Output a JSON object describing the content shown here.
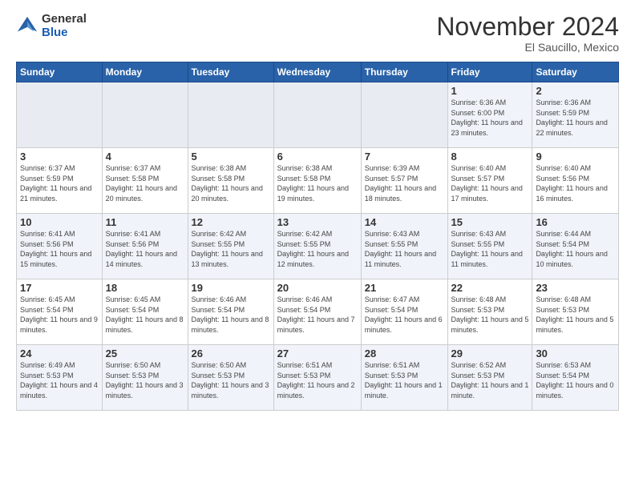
{
  "logo": {
    "general": "General",
    "blue": "Blue"
  },
  "header": {
    "month": "November 2024",
    "location": "El Saucillo, Mexico"
  },
  "weekdays": [
    "Sunday",
    "Monday",
    "Tuesday",
    "Wednesday",
    "Thursday",
    "Friday",
    "Saturday"
  ],
  "rows": [
    [
      {
        "day": "",
        "info": ""
      },
      {
        "day": "",
        "info": ""
      },
      {
        "day": "",
        "info": ""
      },
      {
        "day": "",
        "info": ""
      },
      {
        "day": "",
        "info": ""
      },
      {
        "day": "1",
        "info": "Sunrise: 6:36 AM\nSunset: 6:00 PM\nDaylight: 11 hours and 23 minutes."
      },
      {
        "day": "2",
        "info": "Sunrise: 6:36 AM\nSunset: 5:59 PM\nDaylight: 11 hours and 22 minutes."
      }
    ],
    [
      {
        "day": "3",
        "info": "Sunrise: 6:37 AM\nSunset: 5:59 PM\nDaylight: 11 hours and 21 minutes."
      },
      {
        "day": "4",
        "info": "Sunrise: 6:37 AM\nSunset: 5:58 PM\nDaylight: 11 hours and 20 minutes."
      },
      {
        "day": "5",
        "info": "Sunrise: 6:38 AM\nSunset: 5:58 PM\nDaylight: 11 hours and 20 minutes."
      },
      {
        "day": "6",
        "info": "Sunrise: 6:38 AM\nSunset: 5:58 PM\nDaylight: 11 hours and 19 minutes."
      },
      {
        "day": "7",
        "info": "Sunrise: 6:39 AM\nSunset: 5:57 PM\nDaylight: 11 hours and 18 minutes."
      },
      {
        "day": "8",
        "info": "Sunrise: 6:40 AM\nSunset: 5:57 PM\nDaylight: 11 hours and 17 minutes."
      },
      {
        "day": "9",
        "info": "Sunrise: 6:40 AM\nSunset: 5:56 PM\nDaylight: 11 hours and 16 minutes."
      }
    ],
    [
      {
        "day": "10",
        "info": "Sunrise: 6:41 AM\nSunset: 5:56 PM\nDaylight: 11 hours and 15 minutes."
      },
      {
        "day": "11",
        "info": "Sunrise: 6:41 AM\nSunset: 5:56 PM\nDaylight: 11 hours and 14 minutes."
      },
      {
        "day": "12",
        "info": "Sunrise: 6:42 AM\nSunset: 5:55 PM\nDaylight: 11 hours and 13 minutes."
      },
      {
        "day": "13",
        "info": "Sunrise: 6:42 AM\nSunset: 5:55 PM\nDaylight: 11 hours and 12 minutes."
      },
      {
        "day": "14",
        "info": "Sunrise: 6:43 AM\nSunset: 5:55 PM\nDaylight: 11 hours and 11 minutes."
      },
      {
        "day": "15",
        "info": "Sunrise: 6:43 AM\nSunset: 5:55 PM\nDaylight: 11 hours and 11 minutes."
      },
      {
        "day": "16",
        "info": "Sunrise: 6:44 AM\nSunset: 5:54 PM\nDaylight: 11 hours and 10 minutes."
      }
    ],
    [
      {
        "day": "17",
        "info": "Sunrise: 6:45 AM\nSunset: 5:54 PM\nDaylight: 11 hours and 9 minutes."
      },
      {
        "day": "18",
        "info": "Sunrise: 6:45 AM\nSunset: 5:54 PM\nDaylight: 11 hours and 8 minutes."
      },
      {
        "day": "19",
        "info": "Sunrise: 6:46 AM\nSunset: 5:54 PM\nDaylight: 11 hours and 8 minutes."
      },
      {
        "day": "20",
        "info": "Sunrise: 6:46 AM\nSunset: 5:54 PM\nDaylight: 11 hours and 7 minutes."
      },
      {
        "day": "21",
        "info": "Sunrise: 6:47 AM\nSunset: 5:54 PM\nDaylight: 11 hours and 6 minutes."
      },
      {
        "day": "22",
        "info": "Sunrise: 6:48 AM\nSunset: 5:53 PM\nDaylight: 11 hours and 5 minutes."
      },
      {
        "day": "23",
        "info": "Sunrise: 6:48 AM\nSunset: 5:53 PM\nDaylight: 11 hours and 5 minutes."
      }
    ],
    [
      {
        "day": "24",
        "info": "Sunrise: 6:49 AM\nSunset: 5:53 PM\nDaylight: 11 hours and 4 minutes."
      },
      {
        "day": "25",
        "info": "Sunrise: 6:50 AM\nSunset: 5:53 PM\nDaylight: 11 hours and 3 minutes."
      },
      {
        "day": "26",
        "info": "Sunrise: 6:50 AM\nSunset: 5:53 PM\nDaylight: 11 hours and 3 minutes."
      },
      {
        "day": "27",
        "info": "Sunrise: 6:51 AM\nSunset: 5:53 PM\nDaylight: 11 hours and 2 minutes."
      },
      {
        "day": "28",
        "info": "Sunrise: 6:51 AM\nSunset: 5:53 PM\nDaylight: 11 hours and 1 minute."
      },
      {
        "day": "29",
        "info": "Sunrise: 6:52 AM\nSunset: 5:53 PM\nDaylight: 11 hours and 1 minute."
      },
      {
        "day": "30",
        "info": "Sunrise: 6:53 AM\nSunset: 5:54 PM\nDaylight: 11 hours and 0 minutes."
      }
    ]
  ]
}
